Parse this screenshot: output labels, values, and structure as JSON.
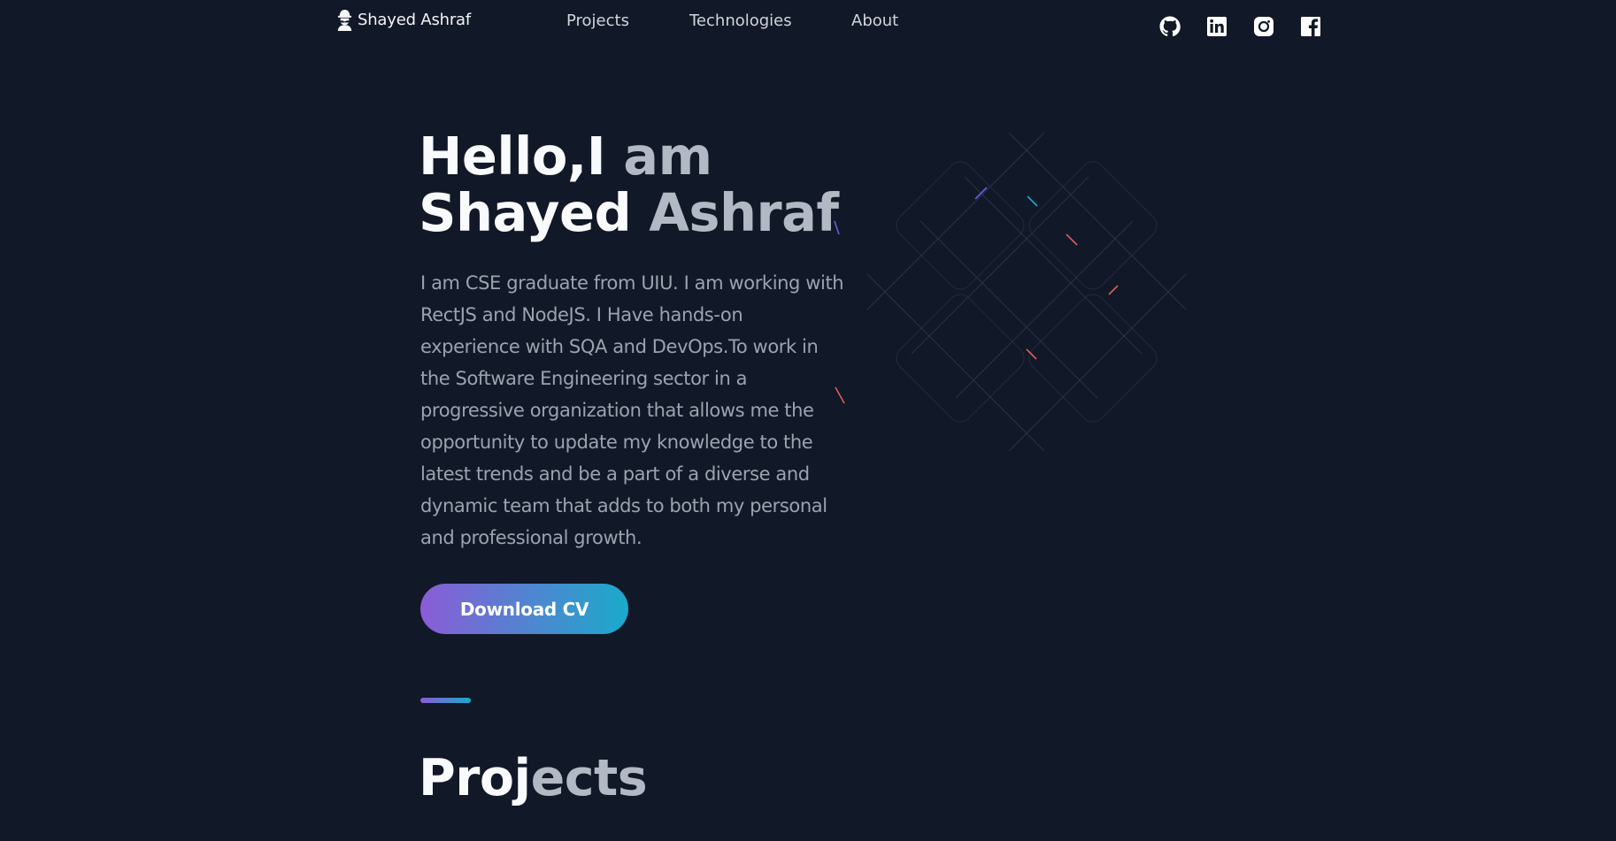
{
  "header": {
    "logo_text": "Shayed Ashraf",
    "logo_icon": "avatar-mustache-icon",
    "nav": [
      {
        "label": "Projects"
      },
      {
        "label": "Technologies"
      },
      {
        "label": "About"
      }
    ],
    "social_icons": [
      "github-icon",
      "linkedin-icon",
      "instagram-icon",
      "facebook-icon"
    ]
  },
  "hero": {
    "title_line1_white": "Hello,I",
    "title_line1_gray": " am",
    "title_line2_white": "Shayed",
    "title_line2_gray": " Ashraf",
    "description": "I am CSE graduate from UIU. I am working with RectJS and NodeJS. I Have hands-on experience with SQA and DevOps.To work in the Software Engineering sector in a progressive organization that allows me the opportunity to update my knowledge to the latest trends and be a part of a diverse and dynamic team that adds to both my personal and professional growth.",
    "cta_label": "Download CV"
  },
  "projects": {
    "title_white": "Proj",
    "title_gray": "ects"
  },
  "colors": {
    "background": "#111827",
    "accent_start": "#8b5cd6",
    "accent_end": "#1aaacb",
    "text_gray": "#9ca3af"
  }
}
